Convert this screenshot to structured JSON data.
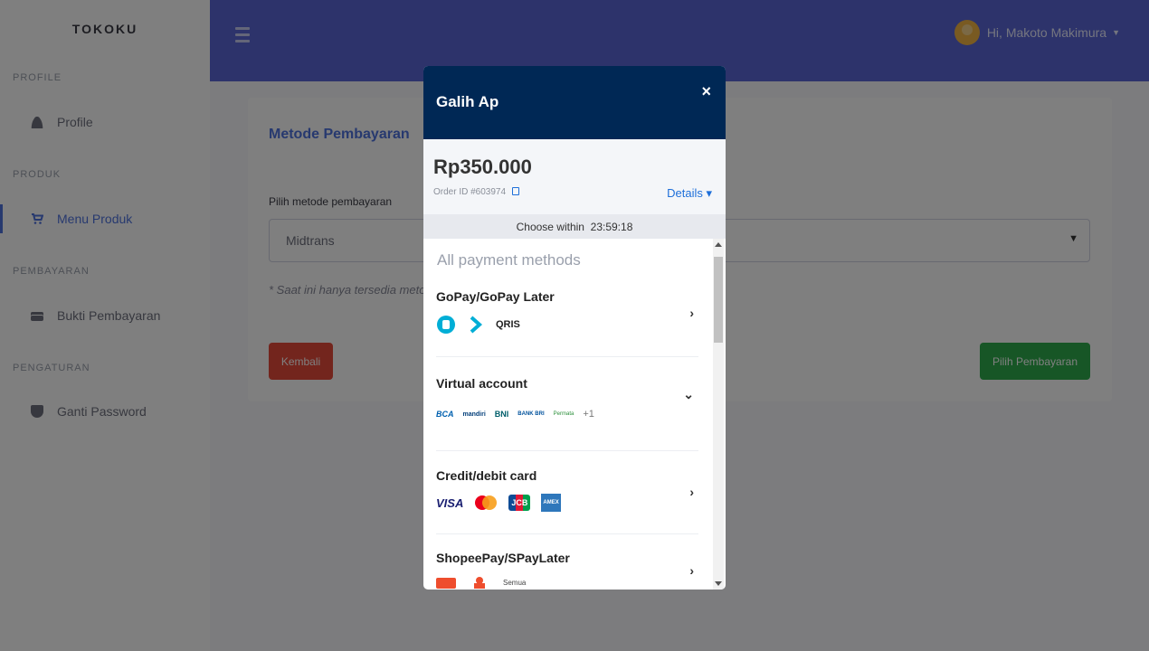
{
  "sidebar": {
    "brand": "TOKOKU",
    "sections": [
      {
        "heading": "PROFILE",
        "item": "Profile"
      },
      {
        "heading": "PRODUK",
        "item": "Menu Produk"
      },
      {
        "heading": "PEMBAYARAN",
        "item": "Bukti Pembayaran"
      },
      {
        "heading": "PENGATURAN",
        "item": "Ganti Password"
      }
    ]
  },
  "topbar": {
    "greeting": "Hi, Makoto Makimura"
  },
  "card": {
    "title": "Metode Pembayaran",
    "field_label": "Pilih metode pembayaran",
    "select_value": "Midtrans",
    "note": "* Saat ini hanya tersedia metode Midtrans",
    "back_label": "Kembali",
    "pay_label": "Pilih Pembayaran"
  },
  "modal": {
    "merchant": "Galih Ap",
    "close": "×",
    "amount": "Rp350.000",
    "order_id": "Order ID #603974",
    "details": "Details ▾",
    "timer_label": "Choose within",
    "timer_value": "23:59:18",
    "list_heading": "All payment methods",
    "methods": [
      {
        "name": "GoPay/GoPay Later",
        "chevron": "›",
        "logos": [
          "gopay-icon",
          "gopaylater-icon",
          "QRIS"
        ]
      },
      {
        "name": "Virtual account",
        "chevron": "⌄",
        "logos": [
          "BCA",
          "mandiri",
          "BNI",
          "BANK BRI",
          "Permata",
          "+1"
        ]
      },
      {
        "name": "Credit/debit card",
        "chevron": "›",
        "logos": [
          "VISA",
          "mastercard-icon",
          "JCB",
          "AMEX"
        ]
      },
      {
        "name": "ShopeePay/SPayLater",
        "chevron": "›",
        "logos": [
          "shopeepay-icon",
          "spaylater-icon",
          "Semua"
        ]
      }
    ]
  },
  "colors": {
    "topbar": "#5a66d6",
    "primary": "#4e73df",
    "danger": "#e74a3b",
    "success": "#2eac4c",
    "modal_header": "#002855"
  }
}
